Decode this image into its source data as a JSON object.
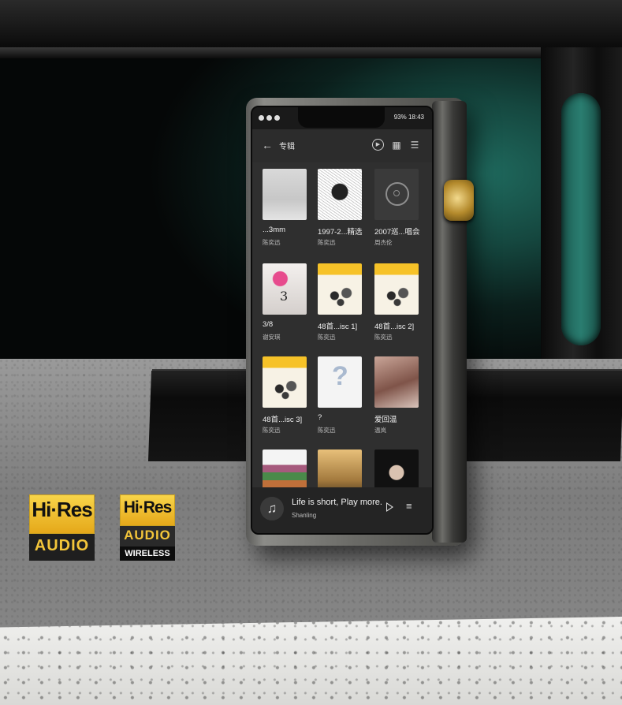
{
  "status_bar": {
    "right": "93% 18:43"
  },
  "header": {
    "title": "专辑"
  },
  "albums": [
    {
      "title": "...3mm",
      "artist": "陈奕迅"
    },
    {
      "title": "1997-2...精选",
      "artist": "陈奕迅"
    },
    {
      "title": "2007巡...唱会",
      "artist": "周杰伦"
    },
    {
      "title": "3/8",
      "artist": "谢安琪"
    },
    {
      "title": "48首...isc 1]",
      "artist": "陈奕迅"
    },
    {
      "title": "48首...isc 2]",
      "artist": "陈奕迅"
    },
    {
      "title": "48首...isc 3]",
      "artist": "陈奕迅"
    },
    {
      "title": "?",
      "artist": "陈奕迅"
    },
    {
      "title": "爱回温",
      "artist": "温岚"
    },
    {
      "title": "",
      "artist": ""
    },
    {
      "title": "",
      "artist": ""
    },
    {
      "title": "",
      "artist": ""
    }
  ],
  "now_playing": {
    "title": "Life is short, Play more.",
    "artist": "Shanling"
  },
  "badges": [
    {
      "hires": "Hi·Res",
      "audio": "AUDIO"
    },
    {
      "hires": "Hi·Res",
      "audio": "AUDIO",
      "wireless": "WIRELESS"
    }
  ],
  "colors": {
    "badge_gold": "#f3c53a",
    "screen_bg": "#2f2f2f"
  }
}
